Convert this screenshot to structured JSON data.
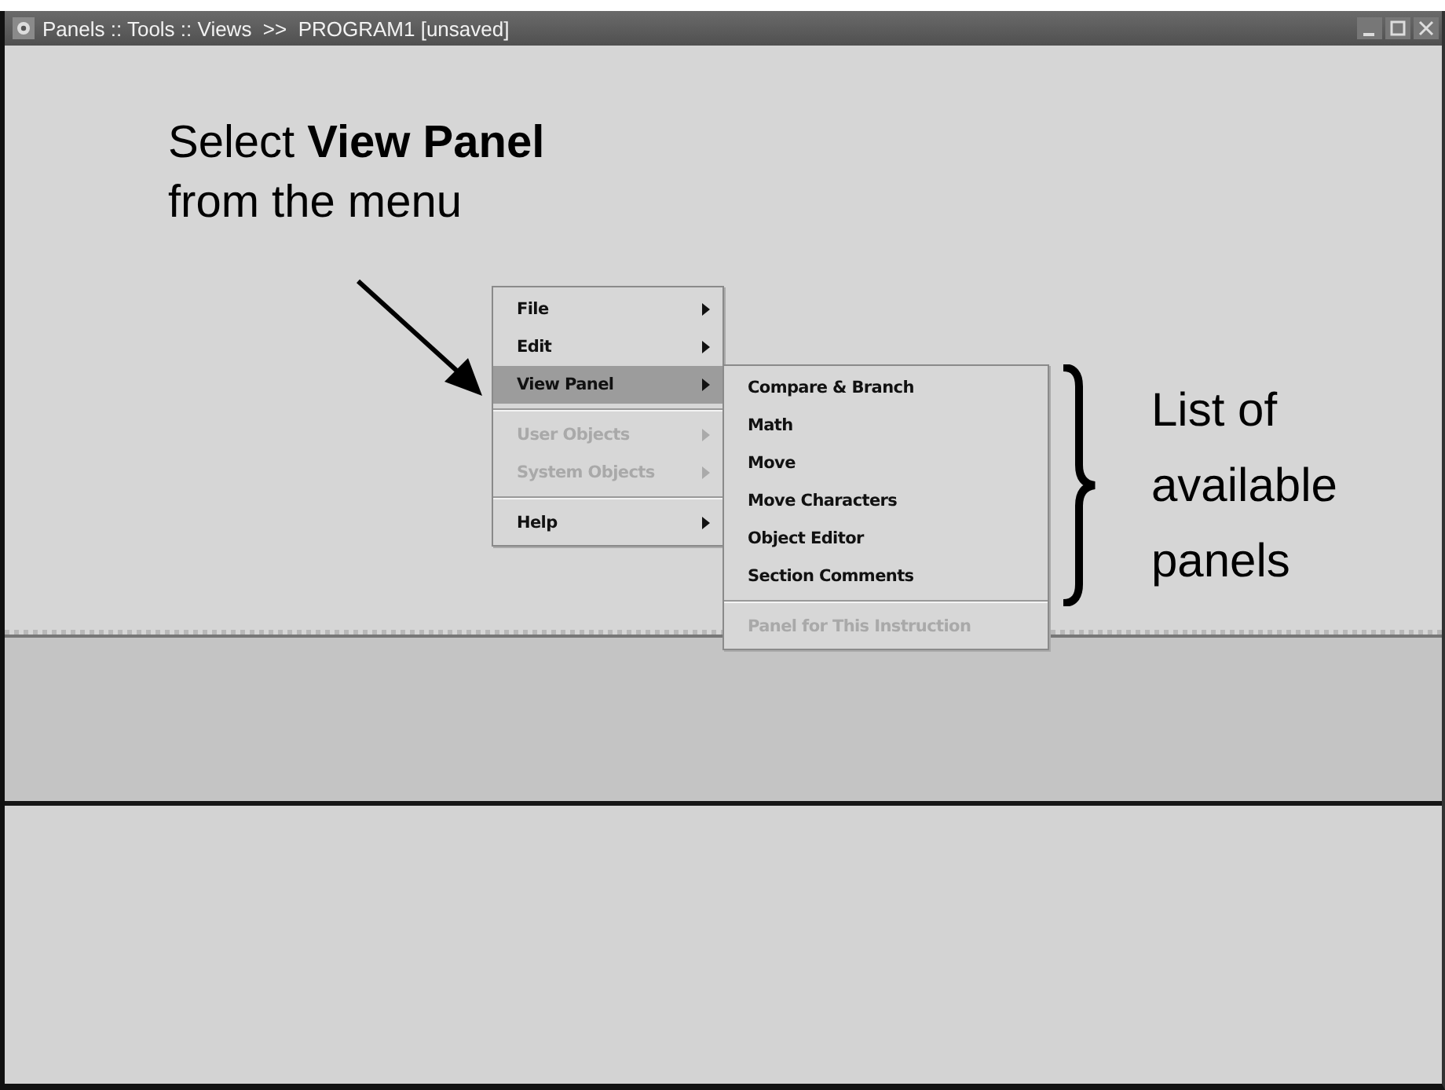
{
  "window": {
    "title": "Panels :: Tools :: Views  >>  PROGRAM1 [unsaved]"
  },
  "callout": {
    "text": "Select **View Panel**",
    "text_2": "from the menu"
  },
  "menu": [
    {
      "kind": "item",
      "label": "File",
      "disabled": false,
      "selected": false
    },
    {
      "kind": "item",
      "label": "Edit",
      "disabled": false,
      "selected": false
    },
    {
      "kind": "item",
      "label": "View Panel",
      "disabled": false,
      "selected": true
    },
    {
      "kind": "separator"
    },
    {
      "kind": "item",
      "label": "User Objects",
      "disabled": true,
      "selected": false
    },
    {
      "kind": "item",
      "label": "System Objects",
      "disabled": true,
      "selected": false
    },
    {
      "kind": "separator"
    },
    {
      "kind": "item",
      "label": "Help",
      "disabled": false,
      "selected": false
    }
  ],
  "submenu": [
    {
      "kind": "item",
      "label": "Compare & Branch",
      "disabled": false
    },
    {
      "kind": "item",
      "label": "Math",
      "disabled": false
    },
    {
      "kind": "item",
      "label": "Move",
      "disabled": false
    },
    {
      "kind": "item",
      "label": "Move Characters",
      "disabled": false
    },
    {
      "kind": "item",
      "label": "Object Editor",
      "disabled": false
    },
    {
      "kind": "item",
      "label": "Section Comments",
      "disabled": false
    },
    {
      "kind": "separator"
    },
    {
      "kind": "item",
      "label": "Panel for This Instruction",
      "disabled": true
    }
  ],
  "brace_note": {
    "lines": [
      "List of",
      "available",
      "panels"
    ]
  }
}
